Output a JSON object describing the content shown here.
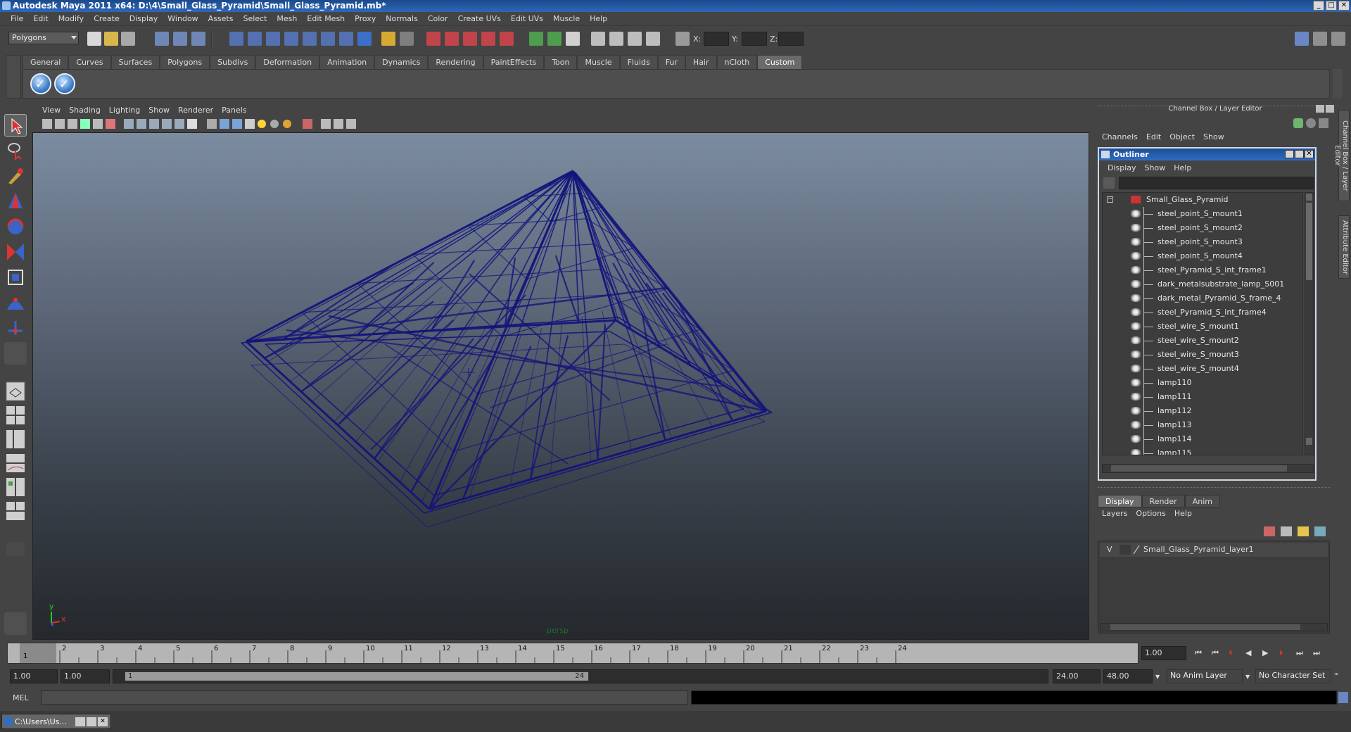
{
  "window": {
    "title": "Autodesk Maya 2011 x64: D:\\4\\Small_Glass_Pyramid\\Small_Glass_Pyramid.mb*",
    "buttons": [
      "_",
      "□",
      "✕"
    ]
  },
  "menubar": [
    "File",
    "Edit",
    "Modify",
    "Create",
    "Display",
    "Window",
    "Assets",
    "Select",
    "Mesh",
    "Edit Mesh",
    "Proxy",
    "Normals",
    "Color",
    "Create UVs",
    "Edit UVs",
    "Muscle",
    "Help"
  ],
  "statusline": {
    "mode_select": "Polygons",
    "coord_labels": {
      "x": "X:",
      "y": "Y:",
      "z": "Z:"
    }
  },
  "shelf": {
    "tabs": [
      "General",
      "Curves",
      "Surfaces",
      "Polygons",
      "Subdivs",
      "Deformation",
      "Animation",
      "Dynamics",
      "Rendering",
      "PaintEffects",
      "Toon",
      "Muscle",
      "Fluids",
      "Fur",
      "Hair",
      "nCloth",
      "Custom"
    ],
    "active_tab": "Custom"
  },
  "viewport": {
    "menu": [
      "View",
      "Shading",
      "Lighting",
      "Show",
      "Renderer",
      "Panels"
    ],
    "camera_label": "persp",
    "axis_x": "x",
    "axis_y": "y",
    "wire_color": "#14147a"
  },
  "channelbox": {
    "title": "Channel Box / Layer Editor",
    "menu": [
      "Channels",
      "Edit",
      "Object",
      "Show"
    ],
    "side_tabs": [
      "Channel Box / Layer Editor",
      "Attribute Editor"
    ]
  },
  "outliner": {
    "title": "Outliner",
    "menu": [
      "Display",
      "Show",
      "Help"
    ],
    "root": "Small_Glass_Pyramid",
    "items": [
      "steel_point_S_mount1",
      "steel_point_S_mount2",
      "steel_point_S_mount3",
      "steel_point_S_mount4",
      "steel_Pyramid_S_int_frame1",
      "dark_metalsubstrate_lamp_S001",
      "dark_metal_Pyramid_S_frame_4",
      "steel_Pyramid_S_int_frame4",
      "steel_wire_S_mount1",
      "steel_wire_S_mount2",
      "steel_wire_S_mount3",
      "steel_wire_S_mount4",
      "lamp110",
      "lamp111",
      "lamp112",
      "lamp113",
      "lamp114",
      "lamp115"
    ]
  },
  "layers": {
    "tabs": [
      "Display",
      "Render",
      "Anim"
    ],
    "active_tab": "Display",
    "menu": [
      "Layers",
      "Options",
      "Help"
    ],
    "rows": [
      {
        "visible": "V",
        "name": "Small_Glass_Pyramid_layer1"
      }
    ]
  },
  "timeline": {
    "ticks": [
      "1",
      "2",
      "3",
      "4",
      "5",
      "6",
      "7",
      "8",
      "9",
      "10",
      "11",
      "12",
      "13",
      "14",
      "15",
      "16",
      "17",
      "18",
      "19",
      "20",
      "21",
      "22",
      "23",
      "24"
    ],
    "current_frame_marker": "1",
    "current_time": "1.00"
  },
  "range": {
    "start": "1.00",
    "playback_start": "1.00",
    "slider_start": "1",
    "slider_end": "24",
    "playback_end": "24.00",
    "end": "48.00",
    "anim_layer": "No Anim Layer",
    "character_set": "No Character Set"
  },
  "cmdline": {
    "label": "MEL"
  },
  "taskbar": {
    "item": "C:\\Users\\Us..."
  }
}
